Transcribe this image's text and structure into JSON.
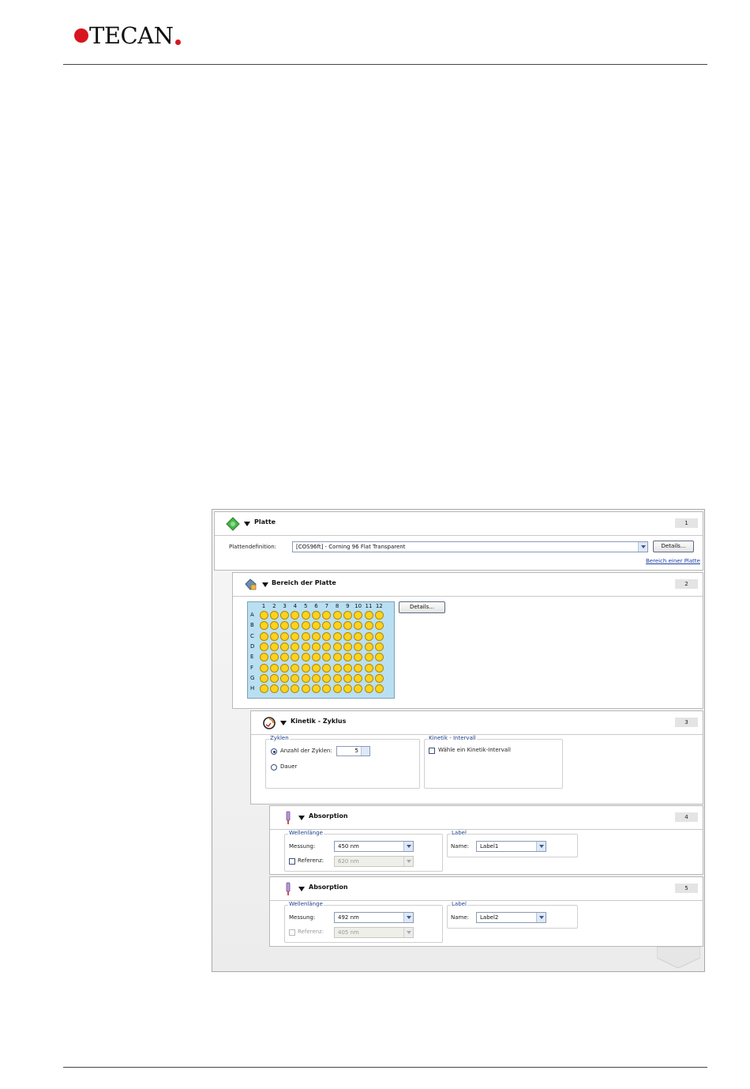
{
  "brand": {
    "name": "TECAN"
  },
  "panels": {
    "platte": {
      "title": "Platte",
      "number": "1",
      "definition_label": "Plattendefinition:",
      "definition_value": "[COS96ft] - Corning 96 Flat Transparent",
      "details_button": "Details...",
      "range_link": "Bereich einer Platte"
    },
    "bereich": {
      "title": "Bereich der Platte",
      "number": "2",
      "details_button": "Details...",
      "columns": [
        "1",
        "2",
        "3",
        "4",
        "5",
        "6",
        "7",
        "8",
        "9",
        "10",
        "11",
        "12"
      ],
      "rows": [
        "A",
        "B",
        "C",
        "D",
        "E",
        "F",
        "G",
        "H"
      ]
    },
    "kinetik": {
      "title": "Kinetik - Zyklus",
      "number": "3",
      "zyklen_group": "Zyklen",
      "anzahl_label": "Anzahl der Zyklen:",
      "anzahl_value": "5",
      "dauer_label": "Dauer",
      "intervall_group": "Kinetik - Intervall",
      "intervall_check": "Wähle ein Kinetik-Intervall"
    },
    "absorption1": {
      "title": "Absorption",
      "number": "4",
      "wl_group": "Wellenlänge",
      "messung_label": "Messung:",
      "messung_value": "450 nm",
      "referenz_label": "Referenz:",
      "referenz_value": "620 nm",
      "label_group": "Label",
      "name_label": "Name:",
      "name_value": "Label1"
    },
    "absorption2": {
      "title": "Absorption",
      "number": "5",
      "wl_group": "Wellenlänge",
      "messung_label": "Messung:",
      "messung_value": "492 nm",
      "referenz_label": "Referenz:",
      "referenz_value": "405 nm",
      "label_group": "Label",
      "name_label": "Name:",
      "name_value": "Label2"
    }
  },
  "colors": {
    "brand_red": "#d7151f",
    "well_yellow": "#ffd21c",
    "plate_blue": "#b9dff2",
    "group_title": "#1c3f8c"
  },
  "icons": {
    "platte": "plate-icon",
    "bereich": "plate-range-icon",
    "kinetik": "kinetic-cycle-icon",
    "absorption": "absorbance-icon"
  }
}
